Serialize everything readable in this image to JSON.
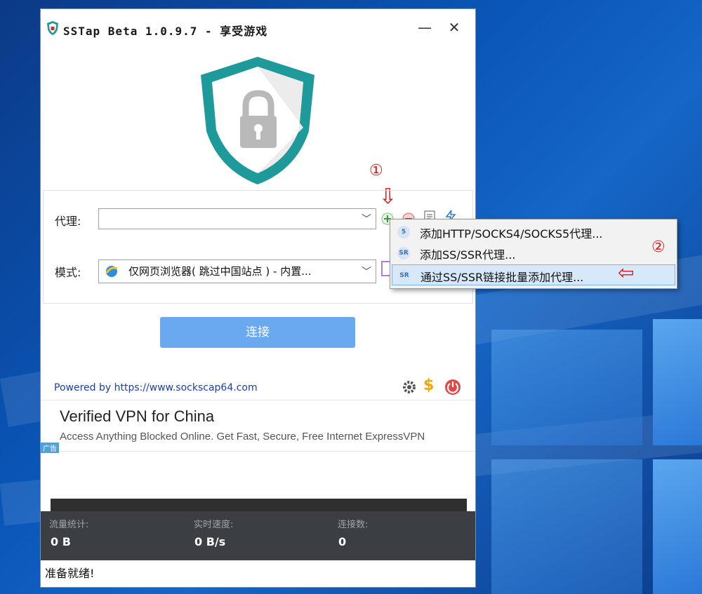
{
  "window": {
    "title": "SSTap Beta 1.0.9.7 - 享受游戏",
    "minimize_glyph": "—",
    "close_glyph": "✕"
  },
  "form": {
    "proxy_label": "代理:",
    "proxy_value": "",
    "mode_label": "模式:",
    "mode_value": "仅网页浏览器( 跳过中国站点 ) - 内置..."
  },
  "connect_label": "连接",
  "powered_by": "Powered by https://www.sockscap64.com",
  "ad": {
    "title": "Verified VPN for China",
    "description": "Access Anything Blocked Online. Get Fast, Secure, Free Internet ExpressVPN",
    "tag": "广告"
  },
  "stats": {
    "traffic_label": "流量统计:",
    "traffic_value": "0 B",
    "speed_label": "实时速度:",
    "speed_value": "0 B/s",
    "connections_label": "连接数:",
    "connections_value": "0"
  },
  "status": "准备就绪!",
  "context_menu": {
    "items": [
      {
        "icon": "5",
        "label": "添加HTTP/SOCKS4/SOCKS5代理..."
      },
      {
        "icon": "SR",
        "label": "添加SS/SSR代理..."
      },
      {
        "icon": "SR",
        "label": "通过SS/SSR链接批量添加代理..."
      }
    ]
  },
  "annotations": {
    "step1": "①",
    "step2": "②",
    "arrow_down": "⇩",
    "arrow_left": "⇦"
  },
  "colors": {
    "shield": "#1f9a9a",
    "connect_button": "#6aa8f0",
    "annotation": "#d61b1b",
    "stats_bg": "#3b3f44"
  }
}
